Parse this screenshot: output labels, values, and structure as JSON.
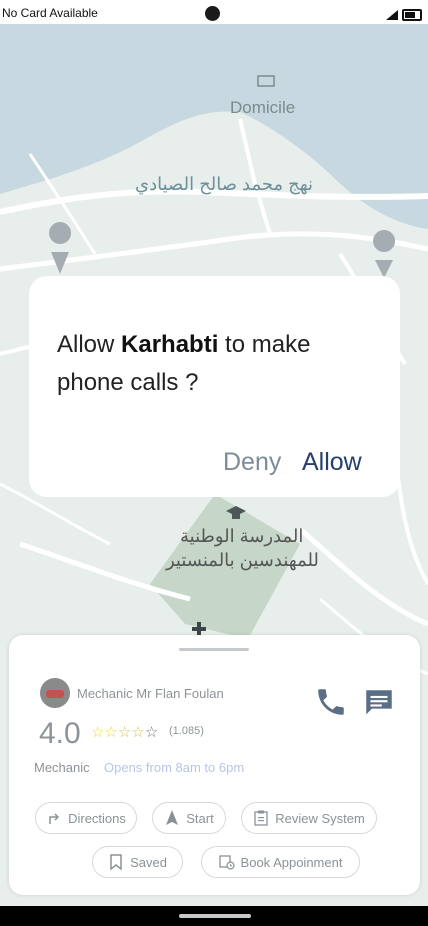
{
  "status_bar": {
    "carrier": "No Card Available"
  },
  "map": {
    "labels": {
      "domicile": "Domicile",
      "street_ar": "نهج محمد صالح الصيادي",
      "school_line1": "المدرسة الوطنية",
      "school_line2": "للمهندسين بالمنستير"
    }
  },
  "dialog": {
    "prefix": "Allow ",
    "app_name": "Karhabti",
    "suffix": " to make phone calls ?",
    "deny_label": "Deny",
    "allow_label": "Allow"
  },
  "card": {
    "name": "Mechanic Mr Flan Foulan",
    "rating": "4.0",
    "review_count": "(1.085)",
    "category": "Mechanic",
    "hours": "Opens from 8am to 6pm",
    "chips": {
      "directions": "Directions",
      "start": "Start",
      "review_system": "Review System",
      "saved": "Saved",
      "book": "Book Appoinment"
    }
  },
  "colors": {
    "allow": "#26406b",
    "deny": "#7d8c9b",
    "map_water": "#c7d8e0",
    "map_park": "#c6d7c9",
    "icon_blue": "#5a6e85"
  }
}
